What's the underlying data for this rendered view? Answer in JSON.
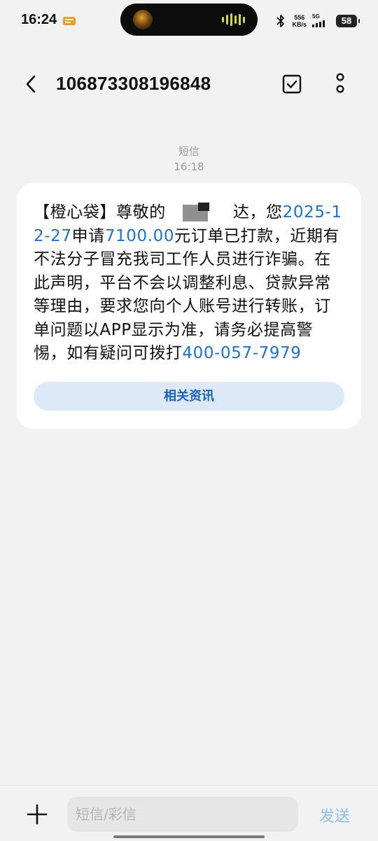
{
  "status_bar": {
    "time": "16:24",
    "net_speed_value": "556",
    "net_speed_unit": "KB/s",
    "network_type": "5G",
    "battery": "58"
  },
  "header": {
    "title": "106873308196848",
    "icons": [
      "back-arrow-icon",
      "select-checkbox-icon",
      "more-vertical-icon"
    ]
  },
  "message": {
    "channel": "短信",
    "time": "16:18",
    "body": {
      "brand": "【橙心袋】尊敬的",
      "after_redact": "达，您",
      "date": "2025-12-27",
      "apply": "申请",
      "amount": "7100.00",
      "main": "元订单已打款，近期有不法分子冒充我司工作人员进行诈骗。在此声明，平台不会以调整利息、贷款异常等理由，要求您向个人账号进行转账，订单问题以APP显示为准，请务必提高警惕，如有疑问可拨打",
      "phone": "400-057-7979"
    },
    "related_button": "相关资讯"
  },
  "input_bar": {
    "placeholder": "短信/彩信",
    "send_label": "发送"
  },
  "colors": {
    "link": "#1a73d9",
    "related_button_bg": "#dde9f7",
    "send_disabled": "#8fbfef",
    "background": "#f2f2f2"
  }
}
